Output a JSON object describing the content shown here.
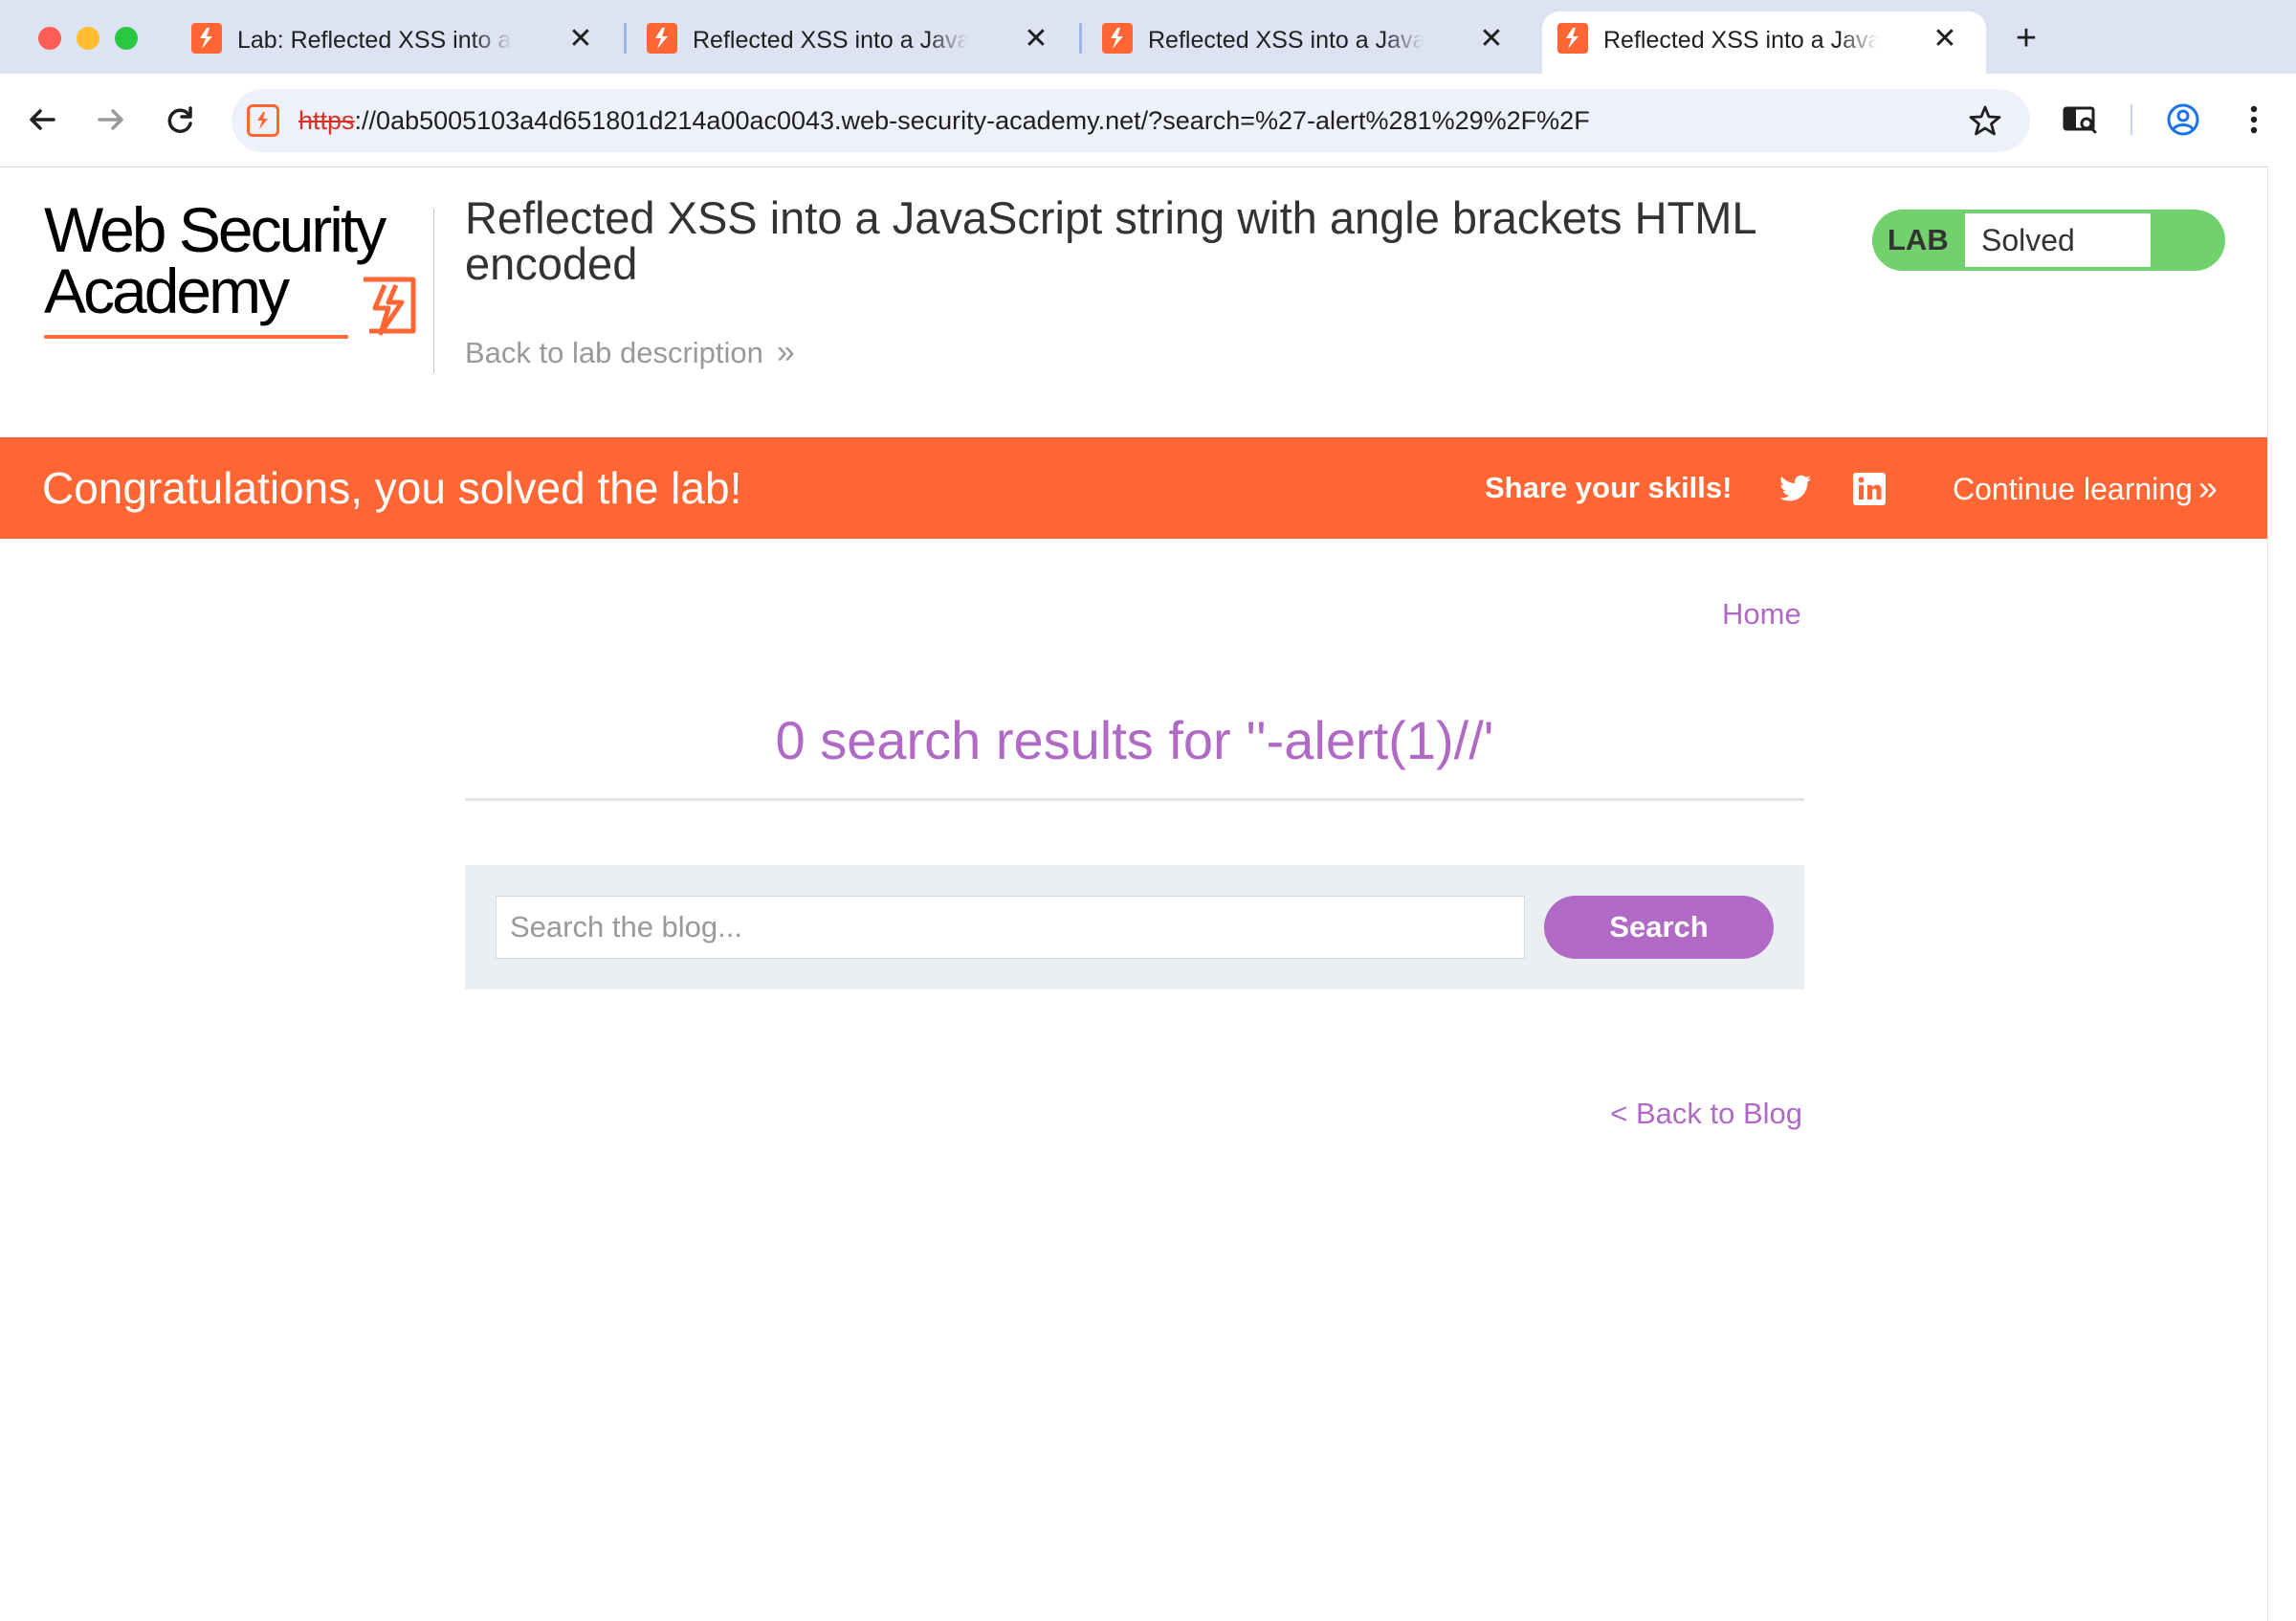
{
  "browser": {
    "tabs": [
      {
        "title": "Lab: Reflected XSS into a JavaScript string with angle brackets HTML encoded",
        "active": false
      },
      {
        "title": "Reflected XSS into a JavaScript string with angle brackets HTML encoded",
        "active": false
      },
      {
        "title": "Reflected XSS into a JavaScript string with angle brackets HTML encoded",
        "active": false
      },
      {
        "title": "Reflected XSS into a JavaScript string with angle brackets HTML encoded",
        "active": true
      }
    ],
    "tab_close_glyph": "✕",
    "new_tab_glyph": "+",
    "url_scheme": "https",
    "url_rest": "://0ab5005103a4d651801d214a00ac0043.web-security-academy.net/?search=%27-alert%281%29%2F%2F",
    "icons": {
      "back": "arrow-left-icon",
      "forward": "arrow-right-icon",
      "reload": "reload-icon",
      "bookmark": "star-icon",
      "lens": "search-tab-icon",
      "profile": "profile-icon",
      "menu": "kebab-menu-icon"
    }
  },
  "header": {
    "logo_line1": "Web Security",
    "logo_line2": "Academy",
    "lab_title": "Reflected XSS into a JavaScript string with angle brackets HTML encoded",
    "back_to_description": "Back to lab description",
    "status_label": "LAB",
    "status_value": "Solved"
  },
  "banner": {
    "message": "Congratulations, you solved the lab!",
    "share": "Share your skills!",
    "continue": "Continue learning",
    "social_icons": [
      "twitter-icon",
      "linkedin-icon"
    ]
  },
  "main": {
    "home_link": "Home",
    "results_title": "0 search results for ''-alert(1)//'",
    "search_placeholder": "Search the blog...",
    "search_value": "",
    "search_button": "Search",
    "back_to_blog": "< Back to Blog"
  },
  "colors": {
    "accent_orange": "#ff6633",
    "link_purple": "#b06ac5",
    "solved_green": "#70d16d",
    "tabstrip": "#dde3f3"
  }
}
